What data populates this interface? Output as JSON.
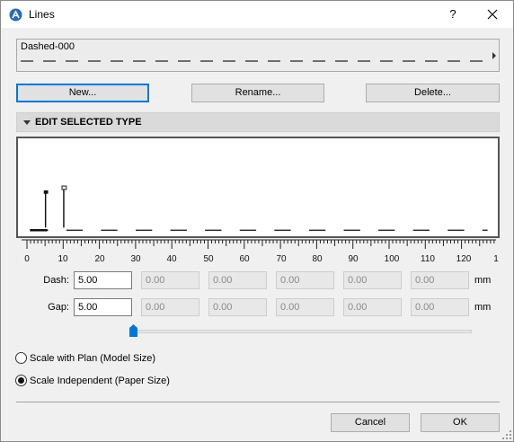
{
  "window": {
    "title": "Lines",
    "help_label": "?"
  },
  "line_type": {
    "name": "Dashed-000"
  },
  "actions": {
    "new_label": "New...",
    "rename_label": "Rename...",
    "delete_label": "Delete..."
  },
  "section": {
    "title": "EDIT SELECTED TYPE"
  },
  "ruler": {
    "labels": [
      "0",
      "10",
      "20",
      "30",
      "40",
      "50",
      "60",
      "70",
      "80",
      "90",
      "100",
      "110",
      "120",
      "1"
    ]
  },
  "dash": {
    "label": "Dash:",
    "values": [
      "5.00",
      "0.00",
      "0.00",
      "0.00",
      "0.00",
      "0.00"
    ],
    "unit": "mm"
  },
  "gap": {
    "label": "Gap:",
    "values": [
      "5.00",
      "0.00",
      "0.00",
      "0.00",
      "0.00",
      "0.00"
    ],
    "unit": "mm"
  },
  "scale": {
    "model_label": "Scale with Plan (Model Size)",
    "paper_label": "Scale Independent (Paper Size)",
    "selected": "paper"
  },
  "footer": {
    "cancel_label": "Cancel",
    "ok_label": "OK"
  },
  "colors": {
    "focus": "#0078d7",
    "section_bg": "#dadada",
    "slider": "#0078d7"
  }
}
